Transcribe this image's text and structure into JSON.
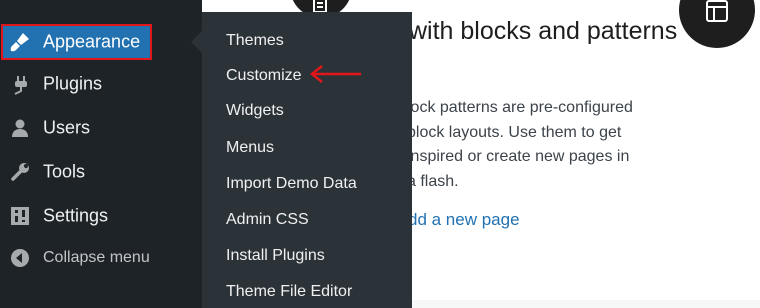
{
  "sidebar": {
    "items": [
      {
        "label": "Appearance",
        "icon": "paintbrush-icon"
      },
      {
        "label": "Plugins",
        "icon": "plugin-icon"
      },
      {
        "label": "Users",
        "icon": "users-icon"
      },
      {
        "label": "Tools",
        "icon": "wrench-icon"
      },
      {
        "label": "Settings",
        "icon": "settings-icon"
      }
    ],
    "collapse_label": "Collapse menu",
    "active_color": "#2271b1",
    "highlight_color": "#e0161b"
  },
  "submenu": {
    "items": [
      "Themes",
      "Customize",
      "Widgets",
      "Menus",
      "Import Demo Data",
      "Admin CSS",
      "Install Plugins",
      "Theme File Editor"
    ],
    "annotated_item": "Customize"
  },
  "content": {
    "title": "with blocks and patterns",
    "description": "lock patterns are pre-configured block layouts. Use them to get inspired or create new pages in a flash.",
    "link": "dd a new page"
  },
  "icons": {
    "top_left": "document-icon",
    "top_right": "layout-icon"
  }
}
